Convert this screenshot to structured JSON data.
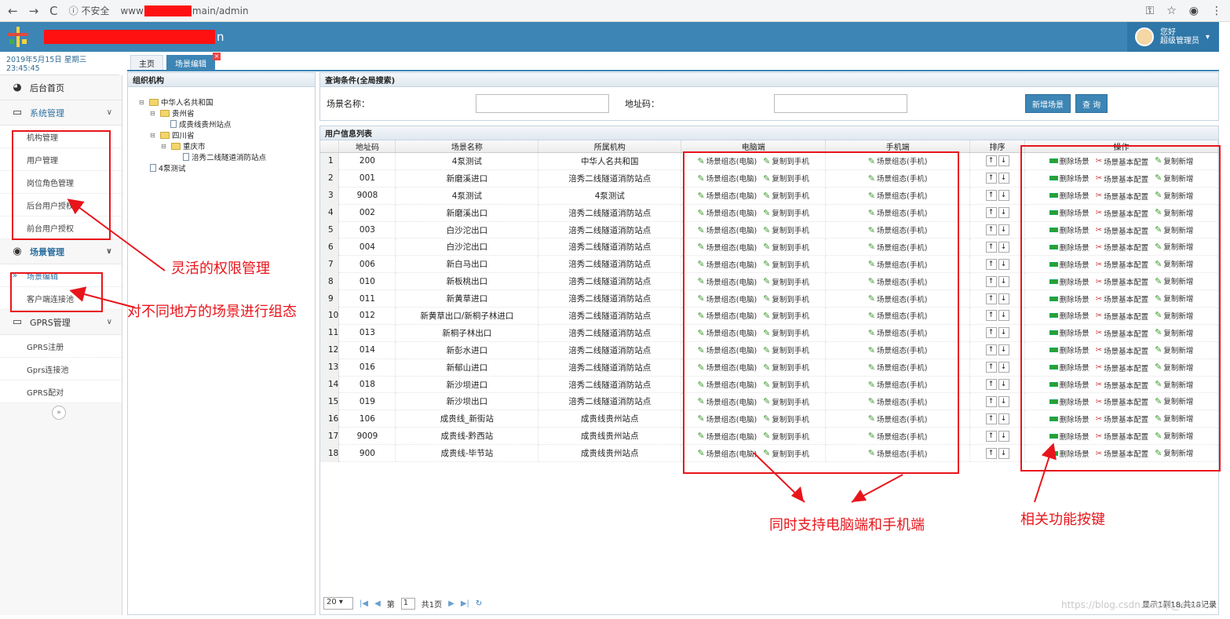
{
  "browser": {
    "back": "←",
    "forward": "→",
    "reload": "C",
    "insecure": "ⓘ 不安全",
    "url_prefix": "www",
    "url_suffix": "main/admin",
    "key_icon": "🔑",
    "star": "☆",
    "account": "●",
    "menu": "⋮"
  },
  "header": {
    "title_tail": "n",
    "greeting": "您好",
    "role": "超级管理员",
    "caret": "▾"
  },
  "datebar": "2019年5月15日 星期三23:45:45",
  "sidebar": {
    "home": "后台首页",
    "sys": "系统管理",
    "sys_items": [
      "机构管理",
      "用户管理",
      "岗位角色管理",
      "后台用户授权",
      "前台用户授权"
    ],
    "scene": "场景管理",
    "scene_items": [
      "场景编辑",
      "客户端连接池"
    ],
    "gprs": "GPRS管理",
    "gprs_items": [
      "GPRS注册",
      "Gprs连接池",
      "GPRS配对"
    ],
    "collapse": "»"
  },
  "tabs": [
    "主页",
    "场景编辑"
  ],
  "org": {
    "title": "组织机构",
    "nodes": [
      "中华人名共和国",
      "贵州省",
      "成贵线贵州站点",
      "四川省",
      "重庆市",
      "涪秀二线隧道消防站点",
      "4泵测试"
    ]
  },
  "query": {
    "title": "查询条件(全局搜索)",
    "name_label": "场景名称：",
    "addr_label": "地址码：",
    "add_button": "新增场景",
    "search_button": "查 询"
  },
  "list": {
    "title": "用户信息列表",
    "columns": [
      "地址码",
      "场景名称",
      "所属机构",
      "电脑端",
      "手机端",
      "排序",
      "操作"
    ],
    "link_pc": "场景组态(电脑)",
    "link_copy": "复制到手机",
    "link_mobile": "场景组态(手机)",
    "op_delete": "删除场景",
    "op_config": "场景基本配置",
    "op_copy_new": "复制新增",
    "up": "↑",
    "down": "↓",
    "rows": [
      {
        "n": "1",
        "addr": "200",
        "name": "4泵测试",
        "org": "中华人名共和国"
      },
      {
        "n": "2",
        "addr": "001",
        "name": "新磨溪进口",
        "org": "涪秀二线隧道消防站点"
      },
      {
        "n": "3",
        "addr": "9008",
        "name": "4泵测试",
        "org": "4泵测试"
      },
      {
        "n": "4",
        "addr": "002",
        "name": "新磨溪出口",
        "org": "涪秀二线隧道消防站点"
      },
      {
        "n": "5",
        "addr": "003",
        "name": "白沙沱出口",
        "org": "涪秀二线隧道消防站点"
      },
      {
        "n": "6",
        "addr": "004",
        "name": "白沙沱出口",
        "org": "涪秀二线隧道消防站点"
      },
      {
        "n": "7",
        "addr": "006",
        "name": "新白马出口",
        "org": "涪秀二线隧道消防站点"
      },
      {
        "n": "8",
        "addr": "010",
        "name": "新板桃出口",
        "org": "涪秀二线隧道消防站点"
      },
      {
        "n": "9",
        "addr": "011",
        "name": "新黄草进口",
        "org": "涪秀二线隧道消防站点"
      },
      {
        "n": "10",
        "addr": "012",
        "name": "新黄草出口/新桐子林进口",
        "org": "涪秀二线隧道消防站点"
      },
      {
        "n": "11",
        "addr": "013",
        "name": "新桐子林出口",
        "org": "涪秀二线隧道消防站点"
      },
      {
        "n": "12",
        "addr": "014",
        "name": "新彭水进口",
        "org": "涪秀二线隧道消防站点"
      },
      {
        "n": "13",
        "addr": "016",
        "name": "新郁山进口",
        "org": "涪秀二线隧道消防站点"
      },
      {
        "n": "14",
        "addr": "018",
        "name": "新沙坝进口",
        "org": "涪秀二线隧道消防站点"
      },
      {
        "n": "15",
        "addr": "019",
        "name": "新沙坝出口",
        "org": "涪秀二线隧道消防站点"
      },
      {
        "n": "16",
        "addr": "106",
        "name": "成贵线_新街站",
        "org": "成贵线贵州站点"
      },
      {
        "n": "17",
        "addr": "9009",
        "name": "成贵线-黔西站",
        "org": "成贵线贵州站点"
      },
      {
        "n": "18",
        "addr": "900",
        "name": "成贵线-毕节站",
        "org": "成贵线贵州站点"
      }
    ]
  },
  "pager": {
    "size": "20 ▾",
    "first": "|◀",
    "prev": "◀",
    "page_pre": "第",
    "page": "1",
    "page_post": "共1页",
    "next": "▶",
    "last": "▶|",
    "refresh": "↻",
    "summary": "显示1到18,共18记录"
  },
  "annotations": {
    "perm": "灵活的权限管理",
    "scene": "对不同地方的场景进行组态",
    "both": "同时支持电脑端和手机端",
    "buttons": "相关功能按键"
  },
  "watermark": "https://blog.csdn.net/qq_xxxxx",
  "colors": {
    "header": "#3c85b5",
    "annotation": "#e8151b"
  }
}
